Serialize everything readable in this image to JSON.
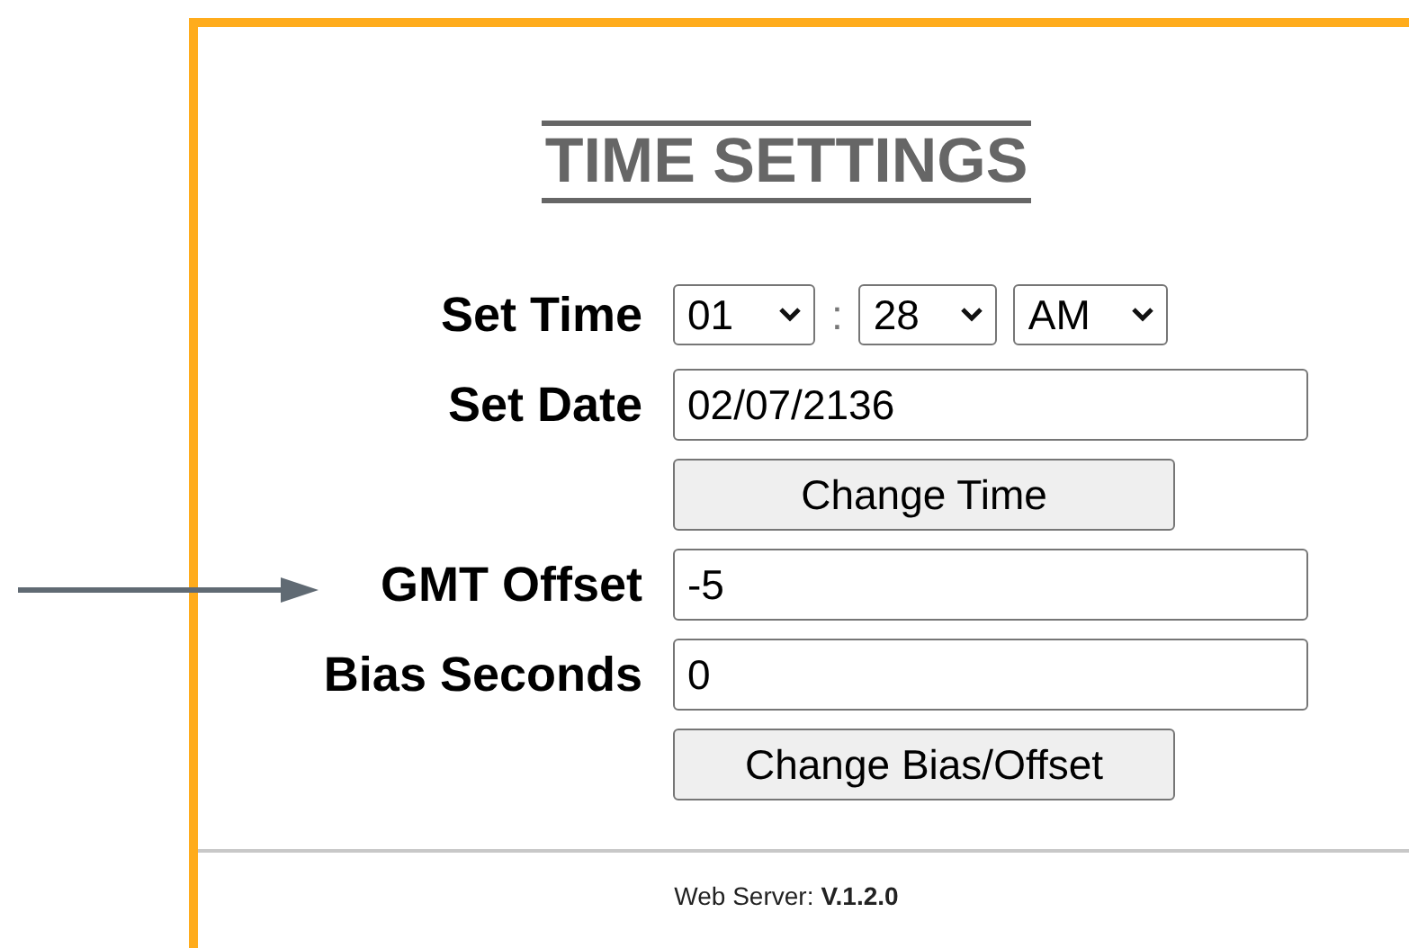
{
  "title": "TIME SETTINGS",
  "rows": [
    {
      "kind": "time",
      "label": "Set Time",
      "hour": "01",
      "separator": ":",
      "minute": "28",
      "period": "AM"
    },
    {
      "kind": "input",
      "label": "Set Date",
      "value": "02/07/2136"
    },
    {
      "kind": "button",
      "text": "Change Time"
    },
    {
      "kind": "input",
      "label": "GMT Offset",
      "value": "-5"
    },
    {
      "kind": "input",
      "label": "Bias Seconds",
      "value": "0"
    },
    {
      "kind": "button",
      "text": "Change Bias/Offset"
    }
  ],
  "footer": {
    "label": "Web Server:",
    "version": "V.1.2.0"
  }
}
